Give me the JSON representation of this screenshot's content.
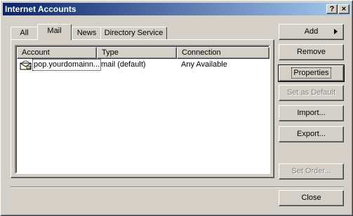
{
  "window": {
    "title": "Internet Accounts",
    "help_label": "?",
    "close_label": "×"
  },
  "tabs": [
    {
      "label": "All"
    },
    {
      "label": "Mail"
    },
    {
      "label": "News"
    },
    {
      "label": "Directory Service"
    }
  ],
  "active_tab": "Mail",
  "list": {
    "columns": [
      "Account",
      "Type",
      "Connection"
    ],
    "rows": [
      {
        "account": "pop.yourdomainn...",
        "type": "mail (default)",
        "connection": "Any Available",
        "icon": "mail-account-icon"
      }
    ]
  },
  "buttons": {
    "add": "Add",
    "remove": "Remove",
    "properties": "Properties",
    "set_default": "Set as Default",
    "import": "Import...",
    "export": "Export...",
    "set_order": "Set Order...",
    "close": "Close"
  },
  "colors": {
    "titlebar_start": "#0a246a",
    "titlebar_end": "#a6caf0",
    "face": "#d4d0c8"
  }
}
